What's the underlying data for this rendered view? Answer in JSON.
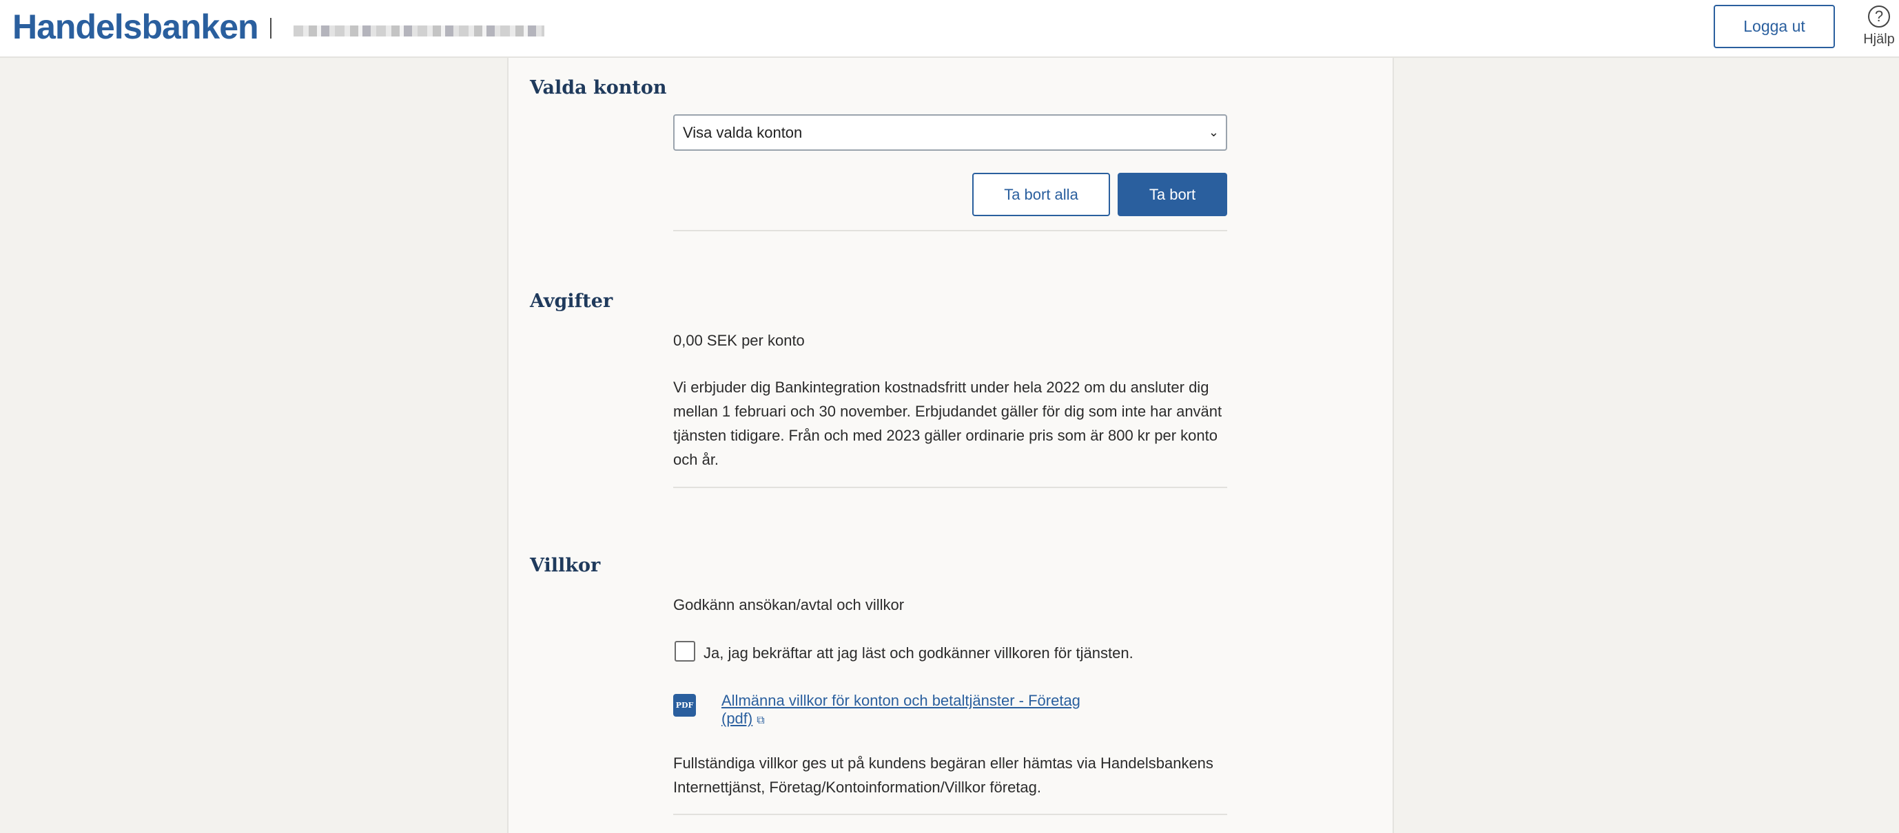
{
  "header": {
    "logo": "Handelsbanken",
    "logout_label": "Logga ut",
    "help_label": "Hjälp"
  },
  "selected_accounts": {
    "title": "Valda konton",
    "select_value": "Visa valda konton",
    "remove_all_label": "Ta bort alla",
    "remove_label": "Ta bort"
  },
  "fees": {
    "title": "Avgifter",
    "price": "0,00 SEK per konto",
    "description_lines": [
      "Vi erbjuder dig Bankintegration kostnadsfritt under hela 2022 om du ansluter dig",
      "mellan 1 februari och 30 november. Erbjudandet gäller för dig som inte har använt",
      "tjänsten tidigare. Från och med 2023 gäller ordinarie pris som är 800 kr per konto",
      "och år."
    ]
  },
  "terms": {
    "title": "Villkor",
    "subtitle": "Godkänn ansökan/avtal och villkor",
    "checkbox_label": "Ja, jag bekräftar att jag läst och godkänner villkoren för tjänsten.",
    "pdf_badge": "PDF",
    "pdf_link_line1": "Allmänna villkor för konton och betaltjänster - Företag",
    "pdf_link_line2": "(pdf)",
    "footer_lines": [
      "Fullständiga villkor ges ut på kundens begäran eller hämtas via Handelsbankens",
      "Internettjänst, Företag/Kontoinformation/Villkor företag."
    ]
  }
}
